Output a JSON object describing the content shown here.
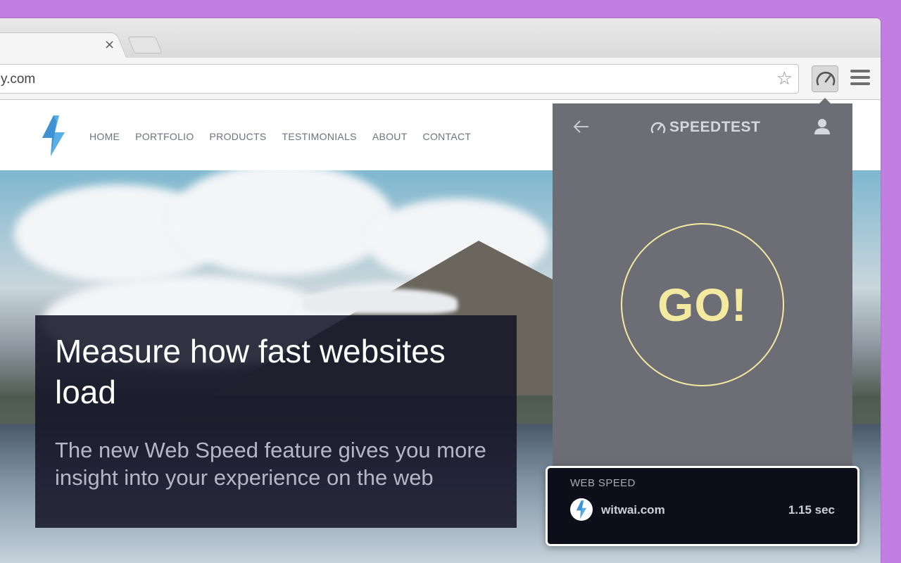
{
  "browser": {
    "tab_close": "×",
    "url": "y.com",
    "star_icon": "☆",
    "extension_icon": "speedometer-icon",
    "menu_icon": "hamburger-icon"
  },
  "site": {
    "logo_icon": "lightning-bolt-icon",
    "nav": [
      "HOME",
      "PORTFOLIO",
      "PRODUCTS",
      "TESTIMONIALS",
      "ABOUT",
      "CONTACT"
    ],
    "hero_title": "Measure how fast websites load",
    "hero_subtitle": "The new Web Speed feature gives you more insight into your experience on the web"
  },
  "popup": {
    "brand": "SPEEDTEST",
    "go_label": "GO!",
    "back_icon": "arrow-left-icon",
    "user_icon": "user-icon"
  },
  "web_speed": {
    "label": "WEB SPEED",
    "site": "witwai.com",
    "time": "1.15 sec"
  },
  "colors": {
    "background": "#c27ee0",
    "popup_bg": "#6d6d76",
    "go_accent": "#f3eaa0",
    "card_bg": "#0e0d1a"
  }
}
